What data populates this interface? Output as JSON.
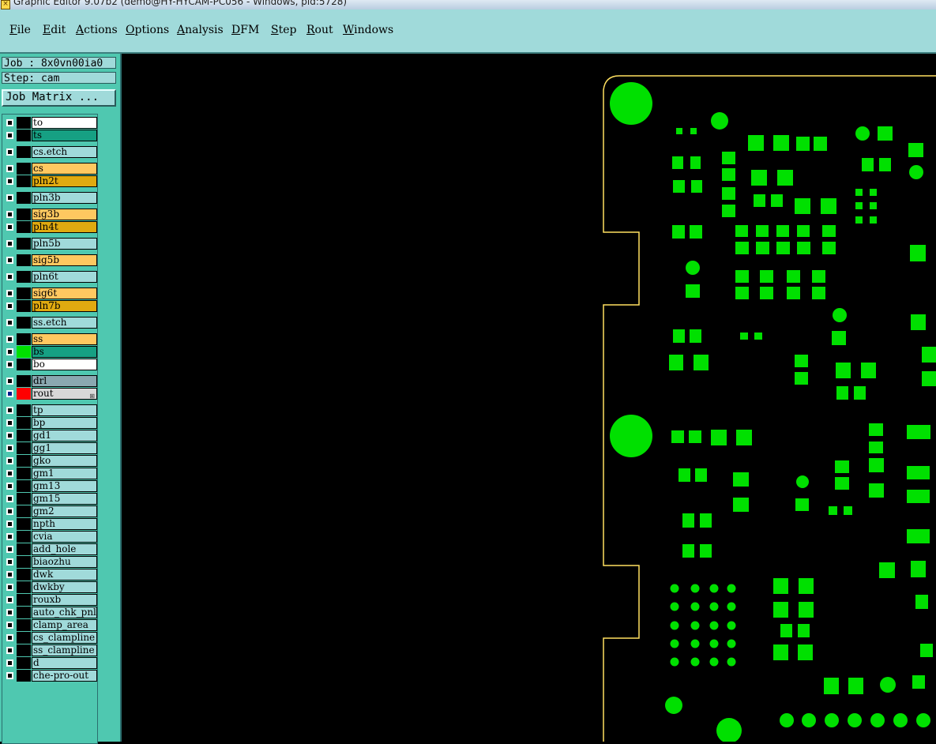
{
  "window": {
    "title": "Graphic Editor 9.07b2 (demo@HY-HYCAM-PC056 - Windows, pid:5728)"
  },
  "menu": [
    "File",
    "Edit",
    "Actions",
    "Options",
    "Analysis",
    "DFM",
    "Step",
    "Rout",
    "Windows"
  ],
  "job": {
    "job_label": "Job : 8x0vn00ia0",
    "step_label": "Step: cam",
    "matrix_button": "Job Matrix ..."
  },
  "colors": {
    "panel_bg": "#4fc8b0",
    "menu_bg": "#a0dada",
    "pads": "#00e000",
    "outline": "#ffe060",
    "canvas": "#000000"
  },
  "layers": [
    {
      "name": "to",
      "color": "#ffffff",
      "swatch": "#000000",
      "checked": false
    },
    {
      "name": "ts",
      "color": "#16a083",
      "swatch": "#000000",
      "checked": false
    },
    {
      "name": "cs.etch",
      "color": "#a0dada",
      "swatch": "#000000",
      "checked": false
    },
    {
      "name": "cs",
      "color": "#ffc860",
      "swatch": "#000000",
      "checked": false
    },
    {
      "name": "pln2t",
      "color": "#e0aa10",
      "swatch": "#000000",
      "checked": false
    },
    {
      "name": "pln3b",
      "color": "#a0dada",
      "swatch": "#000000",
      "checked": false
    },
    {
      "name": "sig3b",
      "color": "#ffc860",
      "swatch": "#000000",
      "checked": false
    },
    {
      "name": "pln4t",
      "color": "#e0aa10",
      "swatch": "#000000",
      "checked": false
    },
    {
      "name": "pln5b",
      "color": "#a0dada",
      "swatch": "#000000",
      "checked": false
    },
    {
      "name": "sig5b",
      "color": "#ffc860",
      "swatch": "#000000",
      "checked": false
    },
    {
      "name": "pln6t",
      "color": "#a0dada",
      "swatch": "#000000",
      "checked": false
    },
    {
      "name": "sig6t",
      "color": "#ffc860",
      "swatch": "#000000",
      "checked": false
    },
    {
      "name": "pln7b",
      "color": "#e0aa10",
      "swatch": "#000000",
      "checked": false
    },
    {
      "name": "ss.etch",
      "color": "#a0dada",
      "swatch": "#000000",
      "checked": false
    },
    {
      "name": "ss",
      "color": "#ffc860",
      "swatch": "#000000",
      "checked": false
    },
    {
      "name": "bs",
      "color": "#16a083",
      "swatch": "#00e000",
      "checked": false
    },
    {
      "name": "bo",
      "color": "#ffffff",
      "swatch": "#000000",
      "checked": false
    },
    {
      "name": "drl",
      "color": "#8aa8b0",
      "swatch": "#000000",
      "checked": false
    },
    {
      "name": "rout",
      "color": "#d8d8d8",
      "swatch": "#ff0000",
      "checked": true,
      "mark": "⊞"
    },
    {
      "name": "tp",
      "color": "#a0dada",
      "swatch": "#000000",
      "checked": false
    },
    {
      "name": "bp",
      "color": "#a0dada",
      "swatch": "#000000",
      "checked": false
    },
    {
      "name": "gd1",
      "color": "#a0dada",
      "swatch": "#000000",
      "checked": false
    },
    {
      "name": "gg1",
      "color": "#a0dada",
      "swatch": "#000000",
      "checked": false
    },
    {
      "name": "gko",
      "color": "#a0dada",
      "swatch": "#000000",
      "checked": false
    },
    {
      "name": "gm1",
      "color": "#a0dada",
      "swatch": "#000000",
      "checked": false
    },
    {
      "name": "gm13",
      "color": "#a0dada",
      "swatch": "#000000",
      "checked": false
    },
    {
      "name": "gm15",
      "color": "#a0dada",
      "swatch": "#000000",
      "checked": false
    },
    {
      "name": "gm2",
      "color": "#a0dada",
      "swatch": "#000000",
      "checked": false
    },
    {
      "name": "npth",
      "color": "#a0dada",
      "swatch": "#000000",
      "checked": false
    },
    {
      "name": "cvia",
      "color": "#a0dada",
      "swatch": "#000000",
      "checked": false
    },
    {
      "name": "add_hole",
      "color": "#a0dada",
      "swatch": "#000000",
      "checked": false
    },
    {
      "name": "biaozhu",
      "color": "#a0dada",
      "swatch": "#000000",
      "checked": false
    },
    {
      "name": "dwk",
      "color": "#a0dada",
      "swatch": "#000000",
      "checked": false
    },
    {
      "name": "dwkby",
      "color": "#a0dada",
      "swatch": "#000000",
      "checked": false
    },
    {
      "name": "rouxb",
      "color": "#a0dada",
      "swatch": "#000000",
      "checked": false
    },
    {
      "name": "auto_chk_pnl",
      "color": "#a0dada",
      "swatch": "#000000",
      "checked": false
    },
    {
      "name": "clamp_area",
      "color": "#a0dada",
      "swatch": "#000000",
      "checked": false
    },
    {
      "name": "cs_clampline",
      "color": "#a0dada",
      "swatch": "#000000",
      "checked": false
    },
    {
      "name": "ss_clampline",
      "color": "#a0dada",
      "swatch": "#000000",
      "checked": false
    },
    {
      "name": "d",
      "color": "#a0dada",
      "swatch": "#000000",
      "checked": false
    },
    {
      "name": "che-pro-out",
      "color": "#a0dada",
      "swatch": "#000000",
      "checked": false
    }
  ]
}
